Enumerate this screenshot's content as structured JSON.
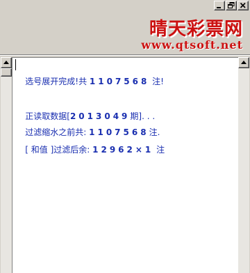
{
  "window": {
    "buttons": [
      {
        "icon": "minimize-icon"
      },
      {
        "icon": "restore-icon"
      },
      {
        "icon": "close-icon"
      }
    ]
  },
  "banner": {
    "title": "晴天彩票网",
    "url": "www.qtsoft.net",
    "color": "#cc1111"
  },
  "output": {
    "text_color": "#1a2fb0",
    "lines": [
      {
        "prefix": "选号展开完成!共 ",
        "number": "1107568",
        "suffix": " 注!"
      },
      {
        "prefix": "正读取数据[",
        "number": "2013049",
        "suffix": "期]. . ."
      },
      {
        "prefix": "过滤缩水之前共: ",
        "number": "1107568",
        "suffix": "注."
      },
      {
        "prefix": "[ 和值 ]过滤后余: ",
        "number": "12962×1",
        "suffix": " 注"
      }
    ]
  }
}
